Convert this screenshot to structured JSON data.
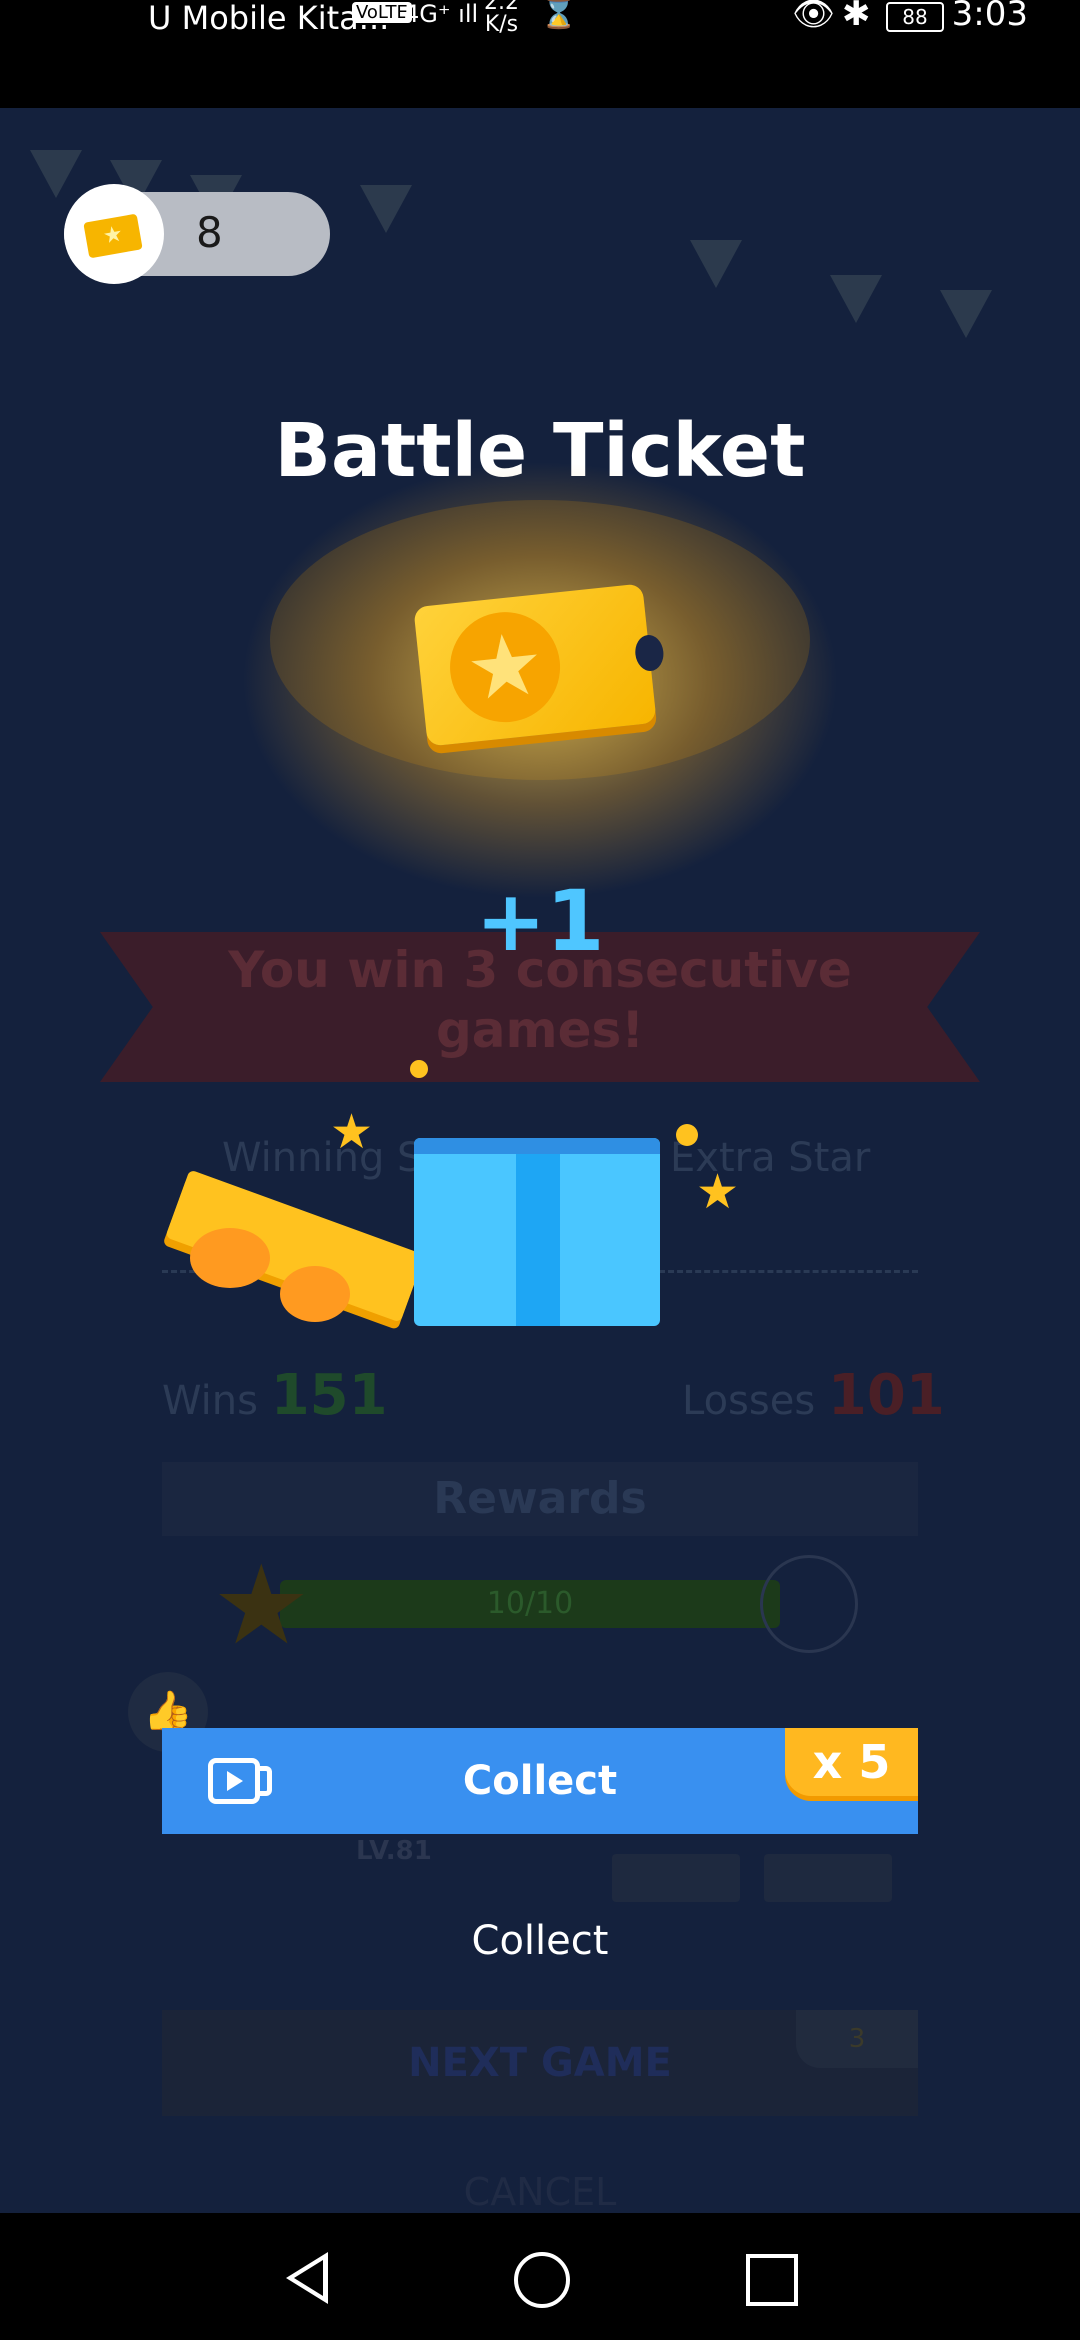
{
  "status_bar": {
    "carrier": "U Mobile Kita...",
    "network_badge": "VoLTE",
    "signal": "4G⁺ ıll",
    "speed_value": "2.2",
    "speed_unit": "K/s",
    "hourglass": "⌛",
    "eye": "👁",
    "bluetooth": "✱",
    "battery": "88",
    "time": "3:03"
  },
  "background": {
    "banner_text": "You win 3 consecutive games!",
    "winning_label": "Winning S",
    "extra_star_label": "Extra Star",
    "wins_label": "Wins",
    "wins_value": "151",
    "losses_label": "Losses",
    "losses_value": "101",
    "rewards_label": "Rewards",
    "progress": "10/10",
    "level": "LV.81",
    "next_game": "NEXT GAME",
    "next_game_cost": "3",
    "cancel": "CANCEL"
  },
  "ticket_counter": {
    "count": "8"
  },
  "reward": {
    "title": "Battle Ticket",
    "amount": "+1"
  },
  "actions": {
    "collect_video_label": "Collect",
    "multiplier": "x 5",
    "collect_label": "Collect"
  },
  "colors": {
    "accent_blue": "#3990f0",
    "gold": "#ffb820",
    "plus_one": "#4fc6ff"
  }
}
